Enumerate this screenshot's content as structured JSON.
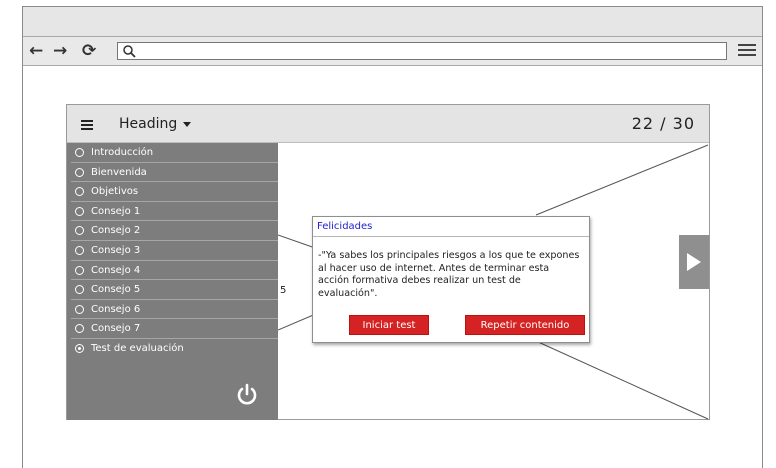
{
  "browser": {
    "nav": {
      "back": "←",
      "forward": "→",
      "reload": "⟳"
    },
    "url": {
      "value": "",
      "placeholder": ""
    }
  },
  "app": {
    "heading": "Heading",
    "page_count": "22 / 30",
    "sidebar": {
      "items": [
        {
          "label": "Introducción",
          "selected": false
        },
        {
          "label": "Bienvenida",
          "selected": false
        },
        {
          "label": "Objetivos",
          "selected": false
        },
        {
          "label": "Consejo 1",
          "selected": false
        },
        {
          "label": "Consejo 2",
          "selected": false
        },
        {
          "label": "Consejo 3",
          "selected": false
        },
        {
          "label": "Consejo 4",
          "selected": false
        },
        {
          "label": "Consejo 5",
          "selected": false
        },
        {
          "label": "Consejo 6",
          "selected": false
        },
        {
          "label": "Consejo 7",
          "selected": false
        },
        {
          "label": "Test de evaluación",
          "selected": true
        }
      ]
    },
    "content_fragment": "5"
  },
  "dialog": {
    "title": "Felicidades",
    "body": "-\"Ya sabes los principales riesgos a los que te expones al hacer uso de internet. Antes de terminar esta acción formativa debes realizar un test de evaluación\".",
    "start_label": "Iniciar test",
    "repeat_label": "Repetir contenido"
  },
  "icons": {
    "power": "power-icon",
    "next": "play-arrow-icon",
    "search": "search-icon",
    "menu": "hamburger-icon"
  },
  "colors": {
    "sidebar": "#7d7d7d",
    "accent_button": "#d52222",
    "dialog_title": "#2222cc"
  }
}
